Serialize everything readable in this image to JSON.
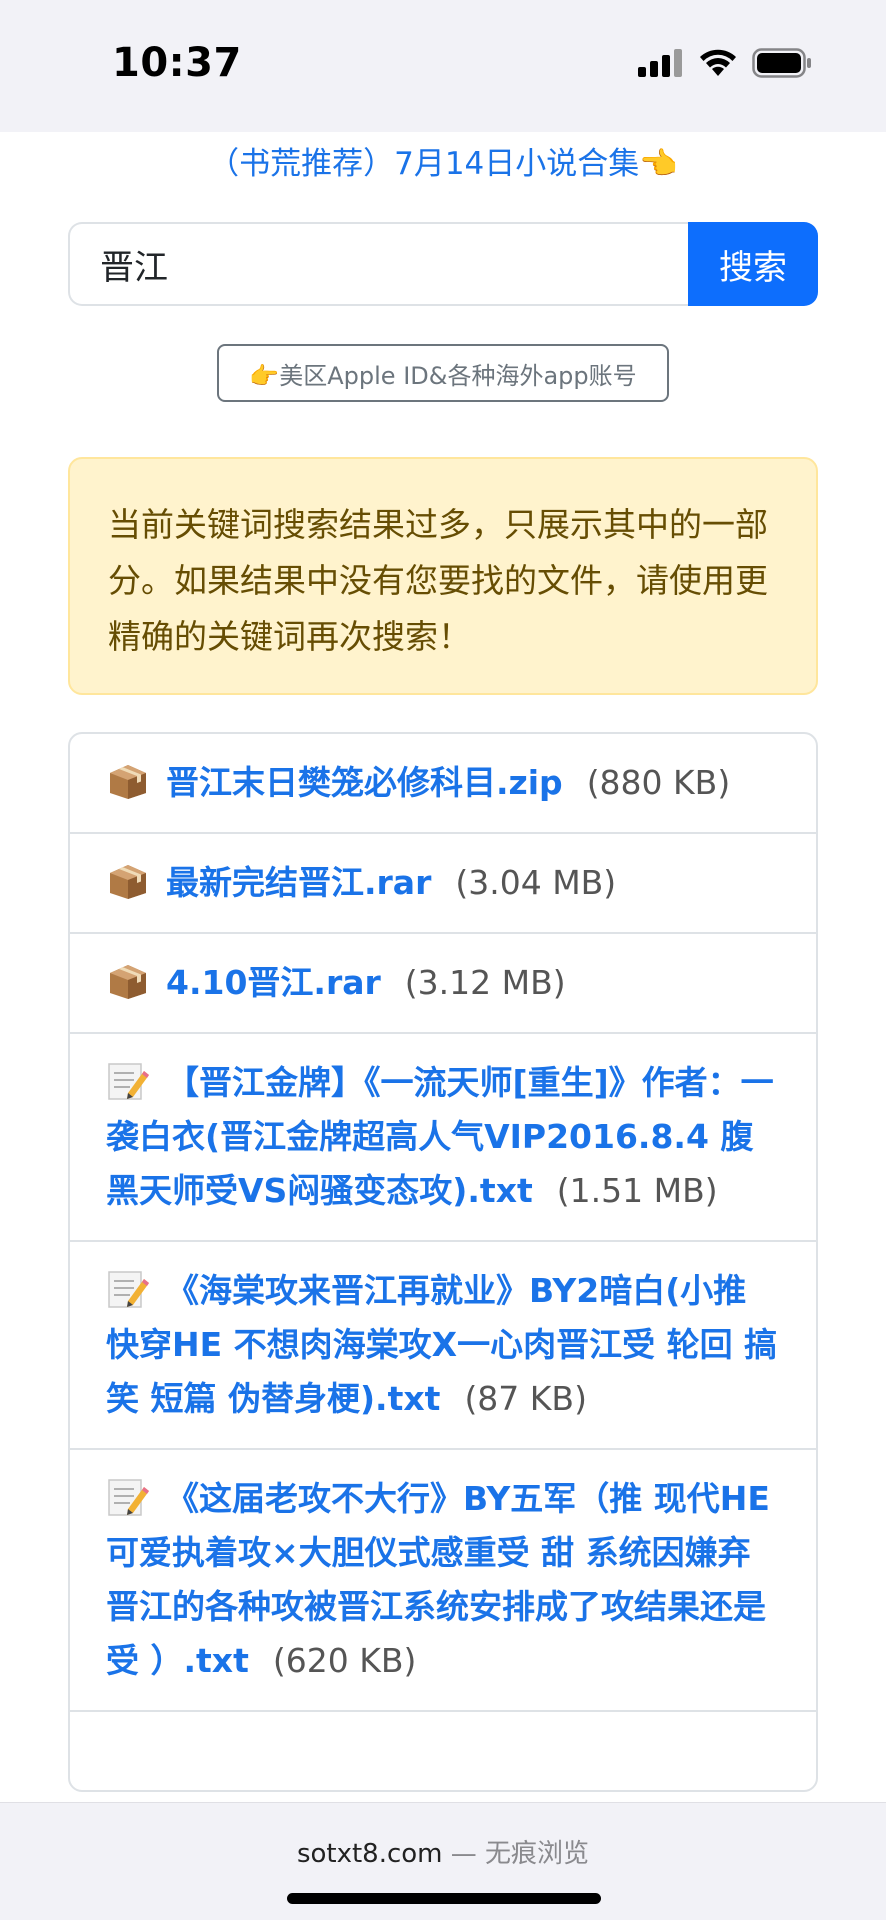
{
  "status": {
    "time": "10:37"
  },
  "promo": {
    "text": "（书荒推荐）7月14日小说合集👈"
  },
  "search": {
    "value": "晋江",
    "button_label": "搜索"
  },
  "ad": {
    "label": "👉美区Apple ID&各种海外app账号"
  },
  "alert": {
    "text": "当前关键词搜索结果过多，只展示其中的一部分。如果结果中没有您要找的文件，请使用更精确的关键词再次搜索！"
  },
  "results": [
    {
      "icon": "package-icon",
      "name": "晋江末日樊笼必修科目.zip",
      "size": "(880 KB)"
    },
    {
      "icon": "package-icon",
      "name": "最新完结晋江.rar",
      "size": "(3.04 MB)"
    },
    {
      "icon": "package-icon",
      "name": "4.10晋江.rar",
      "size": "(3.12 MB)"
    },
    {
      "icon": "memo-icon",
      "name": "【晋江金牌】《一流天师[重生]》作者：一袭白衣(晋江金牌超高人气VIP2016.8.4 腹黑天师受VS闷骚变态攻).txt",
      "size": "(1.51 MB)"
    },
    {
      "icon": "memo-icon",
      "name": "《海棠攻来晋江再就业》BY2暗白(小推 快穿HE 不想肉海棠攻X一心肉晋江受 轮回 搞笑 短篇 伪替身梗).txt",
      "size": "(87 KB)"
    },
    {
      "icon": "memo-icon",
      "name": "《这届老攻不大行》BY五军（推 现代HE 可爱执着攻×大胆仪式感重受 甜 系统因嫌弃晋江的各种攻被晋江系统安排成了攻结果还是受 ）.txt",
      "size": "(620 KB)"
    }
  ],
  "bottom": {
    "domain": "sotxt8.com",
    "separator": " — ",
    "mode": "无痕浏览"
  }
}
